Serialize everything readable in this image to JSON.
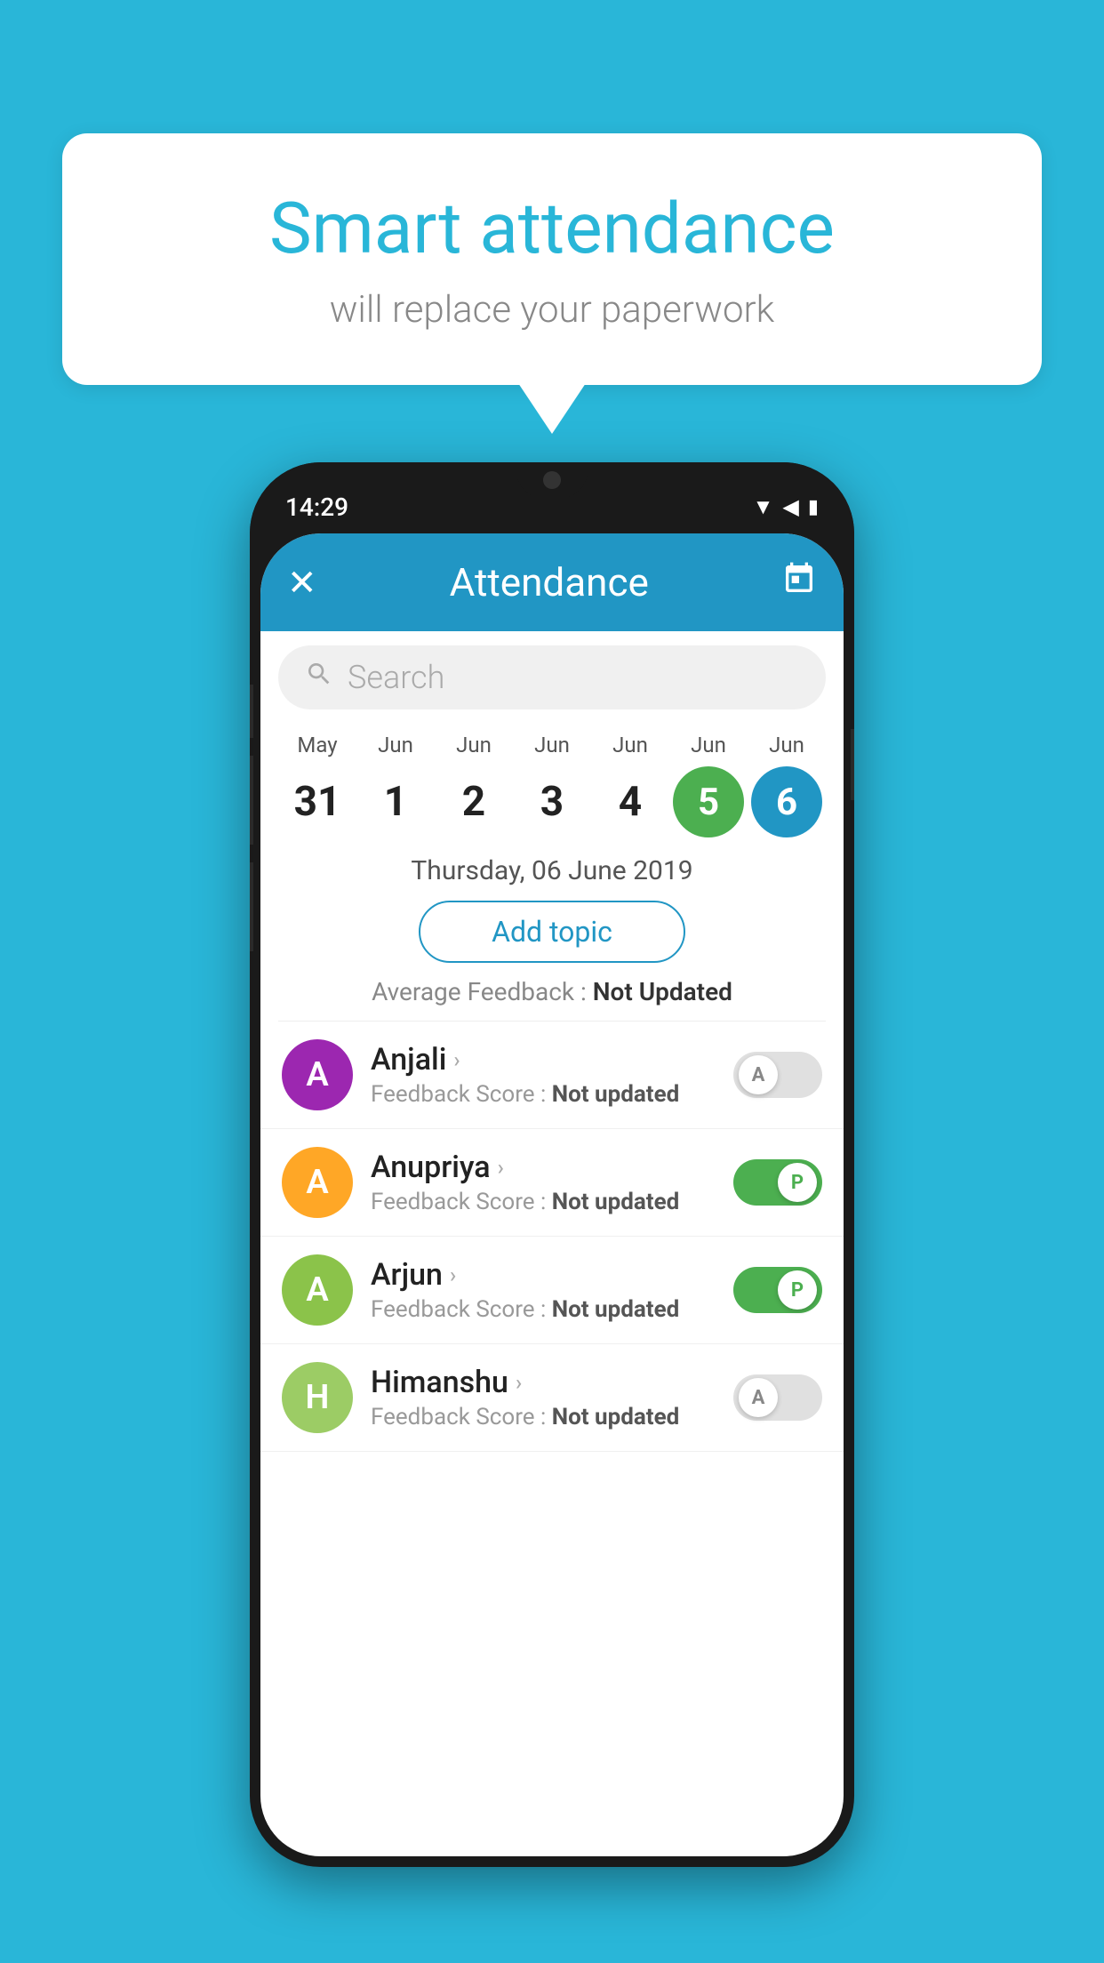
{
  "background_color": "#29b6d8",
  "speech_bubble": {
    "title": "Smart attendance",
    "subtitle": "will replace your paperwork"
  },
  "status_bar": {
    "time": "14:29",
    "icons": [
      "wifi",
      "signal",
      "battery"
    ]
  },
  "app_header": {
    "title": "Attendance",
    "close_label": "✕",
    "calendar_icon": "📅"
  },
  "search": {
    "placeholder": "Search"
  },
  "calendar": {
    "days": [
      {
        "month": "May",
        "number": "31",
        "state": "normal"
      },
      {
        "month": "Jun",
        "number": "1",
        "state": "normal"
      },
      {
        "month": "Jun",
        "number": "2",
        "state": "normal"
      },
      {
        "month": "Jun",
        "number": "3",
        "state": "normal"
      },
      {
        "month": "Jun",
        "number": "4",
        "state": "normal"
      },
      {
        "month": "Jun",
        "number": "5",
        "state": "today"
      },
      {
        "month": "Jun",
        "number": "6",
        "state": "selected"
      }
    ]
  },
  "selected_date": "Thursday, 06 June 2019",
  "add_topic_label": "Add topic",
  "avg_feedback_label": "Average Feedback : ",
  "avg_feedback_value": "Not Updated",
  "students": [
    {
      "name": "Anjali",
      "avatar_letter": "A",
      "avatar_color": "#9c27b0",
      "feedback_label": "Feedback Score : ",
      "feedback_value": "Not updated",
      "toggle": "off",
      "toggle_letter": "A"
    },
    {
      "name": "Anupriya",
      "avatar_letter": "A",
      "avatar_color": "#ffa726",
      "feedback_label": "Feedback Score : ",
      "feedback_value": "Not updated",
      "toggle": "on",
      "toggle_letter": "P"
    },
    {
      "name": "Arjun",
      "avatar_letter": "A",
      "avatar_color": "#8bc34a",
      "feedback_label": "Feedback Score : ",
      "feedback_value": "Not updated",
      "toggle": "on",
      "toggle_letter": "P"
    },
    {
      "name": "Himanshu",
      "avatar_letter": "H",
      "avatar_color": "#9ccc65",
      "feedback_label": "Feedback Score : ",
      "feedback_value": "Not updated",
      "toggle": "off",
      "toggle_letter": "A"
    }
  ]
}
